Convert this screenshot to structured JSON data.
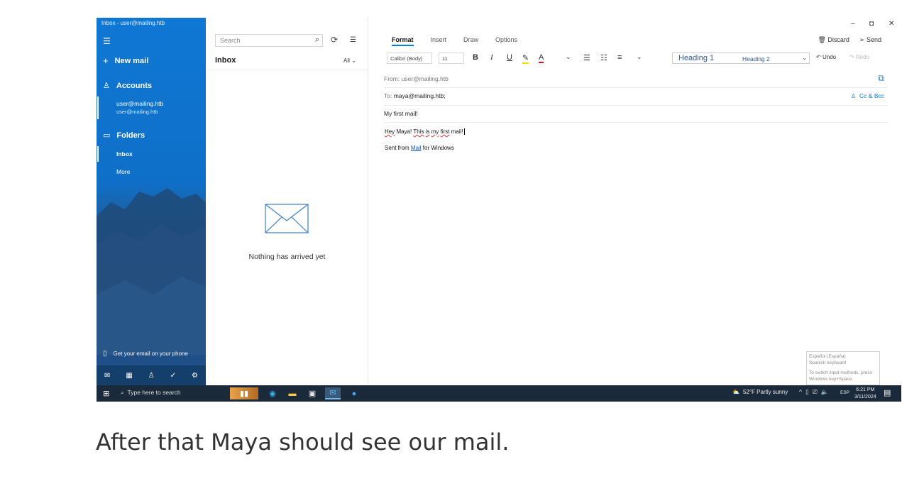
{
  "sidebar": {
    "window_title": "Inbox - user@mailing.htb",
    "new_mail": "New mail",
    "accounts_label": "Accounts",
    "account_name": "user@mailing.htb",
    "account_email": "user@mailing.htb",
    "folders_label": "Folders",
    "folder_inbox": "Inbox",
    "folder_more": "More",
    "phone_promo": "Get your email on your phone"
  },
  "message_list": {
    "search_placeholder": "Search",
    "title": "Inbox",
    "filter": "All",
    "empty_text": "Nothing has arrived yet"
  },
  "compose": {
    "tabs": [
      "Format",
      "Insert",
      "Draw",
      "Options"
    ],
    "discard": "Discard",
    "send": "Send",
    "font_name": "Calibri (Body)",
    "font_size": "11",
    "bold": "B",
    "italic": "I",
    "underline": "U",
    "font_color": "A",
    "heading1": "Heading 1",
    "heading2": "Heading 2",
    "undo": "Undo",
    "redo": "Redo",
    "from_label": "From:",
    "from_value": "user@mailing.htb",
    "to_label": "To:",
    "to_value": "maya@mailing.htb;",
    "cc_bcc": "Cc & Bcc",
    "subject": "My first mail!",
    "body_w1": "Hey",
    "body_w2": " Maya! ",
    "body_w3": "This",
    "body_w4": " ",
    "body_w5": "is",
    "body_w6": " ",
    "body_w7": "my",
    "body_w8": " ",
    "body_w9": "first",
    "body_w10": " mail!",
    "signature_pre": "Sent from ",
    "signature_link": "Mail",
    "signature_post": " for Windows",
    "ime_line1": "Español (España)",
    "ime_line2": "Spanish keyboard",
    "ime_line3": "To switch input methods, press Windows key+Space."
  },
  "taskbar": {
    "search_placeholder": "Type here to search",
    "weather": "52°F  Partly sunny",
    "language": "ESP",
    "time": "6:21 PM",
    "date": "3/11/2024"
  },
  "caption": "After that Maya should see our mail."
}
